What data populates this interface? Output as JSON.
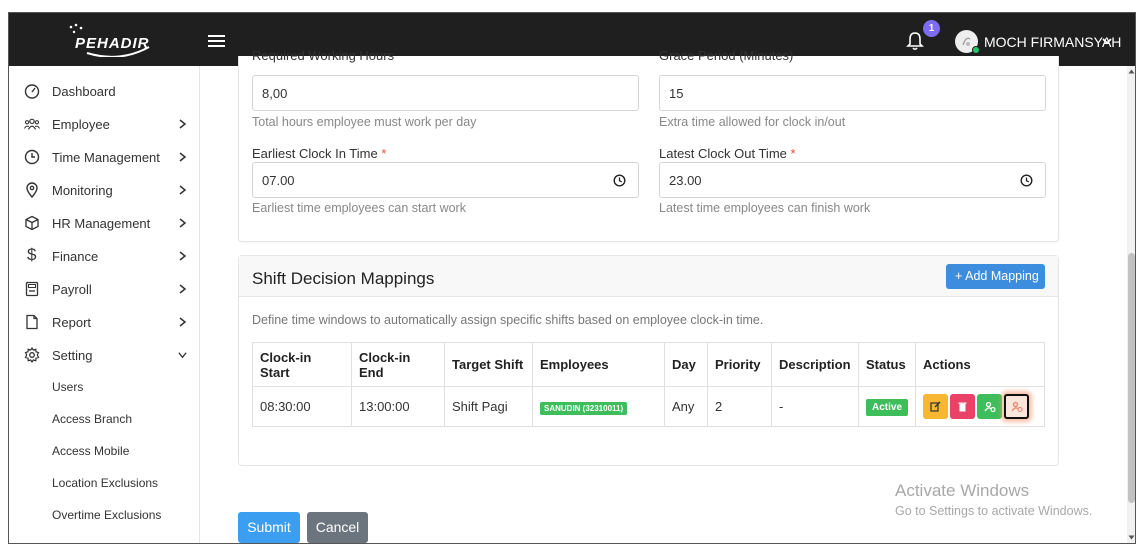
{
  "app": {
    "logo_text": "PEHADIR"
  },
  "topbar": {
    "notification_count": "1",
    "user_name": "MOCH FIRMANSYAH"
  },
  "sidebar": {
    "items": [
      {
        "label": "Dashboard",
        "icon": "dashboard-icon"
      },
      {
        "label": "Employee",
        "icon": "users-icon"
      },
      {
        "label": "Time Management",
        "icon": "clock-icon"
      },
      {
        "label": "Monitoring",
        "icon": "map-pin-icon"
      },
      {
        "label": "HR Management",
        "icon": "box-icon"
      },
      {
        "label": "Finance",
        "icon": "dollar-icon"
      },
      {
        "label": "Payroll",
        "icon": "calculator-icon"
      },
      {
        "label": "Report",
        "icon": "document-icon"
      },
      {
        "label": "Setting",
        "icon": "gear-icon"
      }
    ],
    "setting_subitems": [
      "Users",
      "Access Branch",
      "Access Mobile",
      "Location Exclusions",
      "Overtime Exclusions"
    ]
  },
  "form": {
    "required_hours": {
      "label": "Required Working Hours",
      "value": "8,00",
      "help": "Total hours employee must work per day"
    },
    "grace_period": {
      "label": "Grace Period (Minutes)",
      "value": "15",
      "help": "Extra time allowed for clock in/out"
    },
    "earliest_clock_in": {
      "label": "Earliest Clock In Time",
      "value": "07.00",
      "help": "Earliest time employees can start work"
    },
    "latest_clock_out": {
      "label": "Latest Clock Out Time",
      "value": "23.00",
      "help": "Latest time employees can finish work"
    },
    "required_marker": "*"
  },
  "mappings": {
    "title": "Shift Decision Mappings",
    "add_button": "Add Mapping",
    "add_button_icon": "+",
    "description": "Define time windows to automatically assign specific shifts based on employee clock-in time.",
    "columns": [
      "Clock-in Start",
      "Clock-in End",
      "Target Shift",
      "Employees",
      "Day",
      "Priority",
      "Description",
      "Status",
      "Actions"
    ],
    "rows": [
      {
        "clock_in_start": "08:30:00",
        "clock_in_end": "13:00:00",
        "target_shift": "Shift Pagi",
        "employees": "SANUDIN (32310011)",
        "day": "Any",
        "priority": "2",
        "description": "-",
        "status": "Active"
      }
    ]
  },
  "actions": {
    "submit": "Submit",
    "cancel": "Cancel"
  },
  "watermark": {
    "line1": "Activate Windows",
    "line2": "Go to Settings to activate Windows."
  },
  "colors": {
    "topbar": "#1f1f1f",
    "primary": "#3c8dde",
    "success": "#3ebd5a",
    "danger": "#ea4168",
    "warning": "#f7b731",
    "badge": "#7c6cf0"
  }
}
